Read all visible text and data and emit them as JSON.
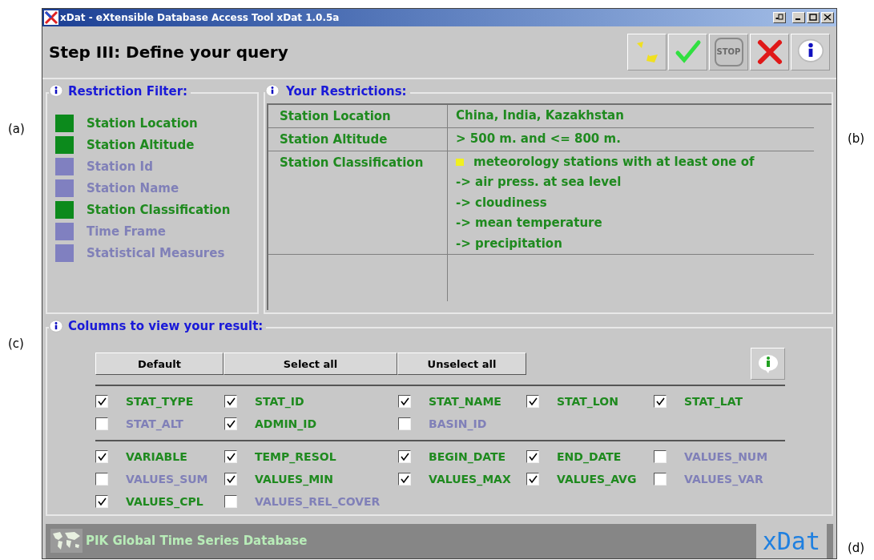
{
  "figure_labels": [
    "(a)",
    "(b)",
    "(c)",
    "(d)"
  ],
  "window": {
    "title": "xDat - eXtensible Database Access Tool xDat 1.0.5a"
  },
  "header": {
    "title": "Step III: Define your query"
  },
  "toolbar": [
    {
      "kind": "wizard",
      "disabled": false
    },
    {
      "kind": "confirm",
      "disabled": false
    },
    {
      "kind": "stop",
      "label": "STOP",
      "disabled": true
    },
    {
      "kind": "cancel",
      "disabled": false
    },
    {
      "kind": "info",
      "disabled": false
    }
  ],
  "restriction_filter": {
    "title": "Restriction Filter:",
    "items": [
      {
        "label": "Station Location",
        "checked": true
      },
      {
        "label": "Station Altitude",
        "checked": true
      },
      {
        "label": "Station Id",
        "checked": false
      },
      {
        "label": "Station Name",
        "checked": false
      },
      {
        "label": "Station Classification",
        "checked": true
      },
      {
        "label": "Time Frame",
        "checked": false
      },
      {
        "label": "Statistical Measures",
        "checked": false
      }
    ]
  },
  "your_restrictions": {
    "title": "Your Restrictions:",
    "rows": [
      {
        "name": "Station Location",
        "lines": [
          {
            "kind": "text",
            "text": "China, India, Kazakhstan"
          }
        ]
      },
      {
        "name": "Station Altitude",
        "lines": [
          {
            "kind": "text",
            "text": "> 500 m. and <= 800 m."
          }
        ]
      },
      {
        "name": "Station Classification",
        "lines": [
          {
            "kind": "bullet",
            "text": "meteorology stations with at least one of"
          },
          {
            "kind": "text",
            "text": "-> air press. at sea level"
          },
          {
            "kind": "text",
            "text": "-> cloudiness"
          },
          {
            "kind": "text",
            "text": "-> mean temperature"
          },
          {
            "kind": "text",
            "text": "-> precipitation"
          }
        ]
      }
    ]
  },
  "columns": {
    "title": "Columns to view your result:",
    "buttons": [
      "Default",
      "Select all",
      "Unselect all"
    ],
    "groups": [
      {
        "items": [
          {
            "label": "STAT_TYPE",
            "checked": true
          },
          {
            "label": "STAT_ID",
            "checked": true
          },
          {
            "label": "STAT_NAME",
            "checked": true
          },
          {
            "label": "STAT_LON",
            "checked": true
          },
          {
            "label": "STAT_LAT",
            "checked": true
          },
          {
            "label": "STAT_ALT",
            "checked": false
          },
          {
            "label": "ADMIN_ID",
            "checked": true
          },
          {
            "label": "BASIN_ID",
            "checked": false
          }
        ]
      },
      {
        "items": [
          {
            "label": "VARIABLE",
            "checked": true
          },
          {
            "label": "TEMP_RESOL",
            "checked": true
          },
          {
            "label": "BEGIN_DATE",
            "checked": true
          },
          {
            "label": "END_DATE",
            "checked": true
          },
          {
            "label": "VALUES_NUM",
            "checked": false
          },
          {
            "label": "VALUES_SUM",
            "checked": false
          },
          {
            "label": "VALUES_MIN",
            "checked": true
          },
          {
            "label": "VALUES_MAX",
            "checked": true
          },
          {
            "label": "VALUES_AVG",
            "checked": true
          },
          {
            "label": "VALUES_VAR",
            "checked": false
          },
          {
            "label": "VALUES_CPL",
            "checked": true
          },
          {
            "label": "VALUES_REL_COVER",
            "checked": false
          }
        ]
      }
    ]
  },
  "footer": {
    "text": "PIK Global Time Series Database",
    "logo": "xDat"
  }
}
